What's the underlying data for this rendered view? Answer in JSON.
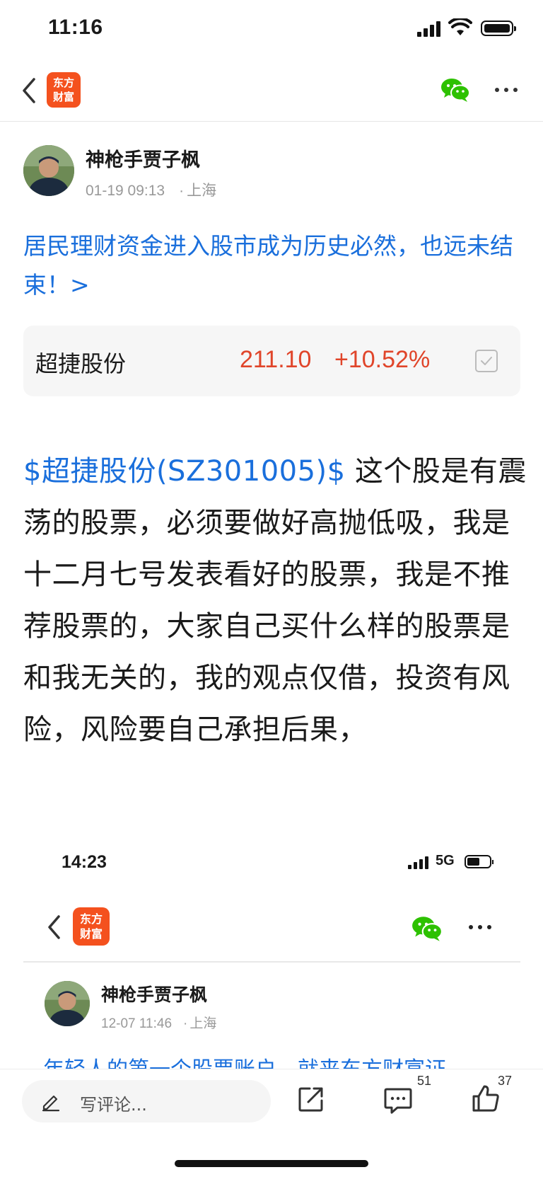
{
  "status_bar": {
    "time": "11:16"
  },
  "nav": {
    "logo_line1": "东方",
    "logo_line2": "财富"
  },
  "author": {
    "name": "神枪手贾子枫",
    "datetime": "01-19 09:13",
    "location": "上海"
  },
  "headline": "居民理财资金进入股市成为历史必然，也远未结束！>",
  "stock_card": {
    "name": "超捷股份",
    "price": "211.10",
    "change": "+10.52%",
    "price_color": "#e0452a"
  },
  "post": {
    "stock_link": "$超捷股份(SZ301005)$",
    "text": "  这个股是有震荡的股票，必须要做好高抛低吸，我是十二月七号发表看好的股票，我是不推荐股票的，大家自己买什么样的股票是和我无关的，我的观点仅借，投资有风险，风险要自己承担后果，"
  },
  "embedded_screenshot": {
    "time": "14:23",
    "network": "5G",
    "logo_line1": "东方",
    "logo_line2": "财富",
    "author_name": "神枪手贾子枫",
    "datetime": "12-07 11:46",
    "location": "上海",
    "cut_text": "年轻人的第一个股票账户，就来东方财富证"
  },
  "bottom_bar": {
    "comment_placeholder": "写评论...",
    "comment_count": "51",
    "like_count": "37"
  },
  "colors": {
    "link_blue": "#1a6fdc",
    "brand_orange": "#f4511e",
    "wechat_green": "#2dc100",
    "stock_up_red": "#e0452a"
  },
  "icons": [
    "back-icon",
    "wechat-icon",
    "more-icon",
    "pencil-icon",
    "share-icon",
    "comment-icon",
    "like-icon",
    "checkbox-icon"
  ]
}
